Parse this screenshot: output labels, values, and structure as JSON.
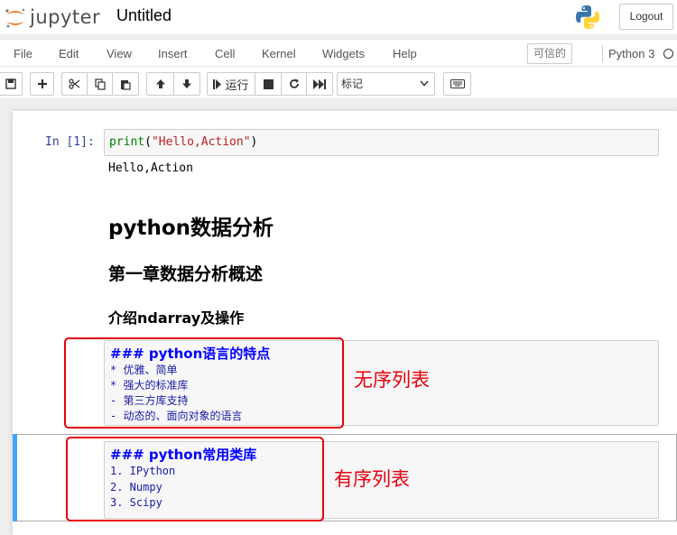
{
  "header": {
    "logo_text": "jupyter",
    "notebook_title": "Untitled",
    "logout_label": "Logout"
  },
  "menubar": {
    "items": [
      "File",
      "Edit",
      "View",
      "Insert",
      "Cell",
      "Kernel",
      "Widgets",
      "Help"
    ],
    "trusted_label": "可信的",
    "kernel_name": "Python 3"
  },
  "toolbar": {
    "run_label": "运行",
    "cell_type": "标记"
  },
  "cells": {
    "code1": {
      "prompt": "In [1]:",
      "func": "print",
      "open": "(",
      "arg": "\"Hello,Action\"",
      "close": ")",
      "output": "Hello,Action"
    },
    "h1": "python数据分析",
    "h2": "第一章数据分析概述",
    "h3": "介绍ndarray及操作",
    "md1": {
      "heading": "### python语言的特点",
      "lines": [
        "* 优雅、简单",
        "* 强大的标准库",
        "- 第三方库支持",
        "- 动态的、面向对象的语言"
      ]
    },
    "md2": {
      "heading": "### python常用类库",
      "lines": [
        "1. IPython",
        "2. Numpy",
        "3. Scipy"
      ]
    }
  },
  "annotations": {
    "unordered": "无序列表",
    "ordered": "有序列表",
    "color": "#e8000b"
  },
  "colors": {
    "prompt": "#303f9f",
    "md_heading": "#0000ff",
    "md_text": "#1a1aa6",
    "selected_bar": "#42a5f5"
  }
}
